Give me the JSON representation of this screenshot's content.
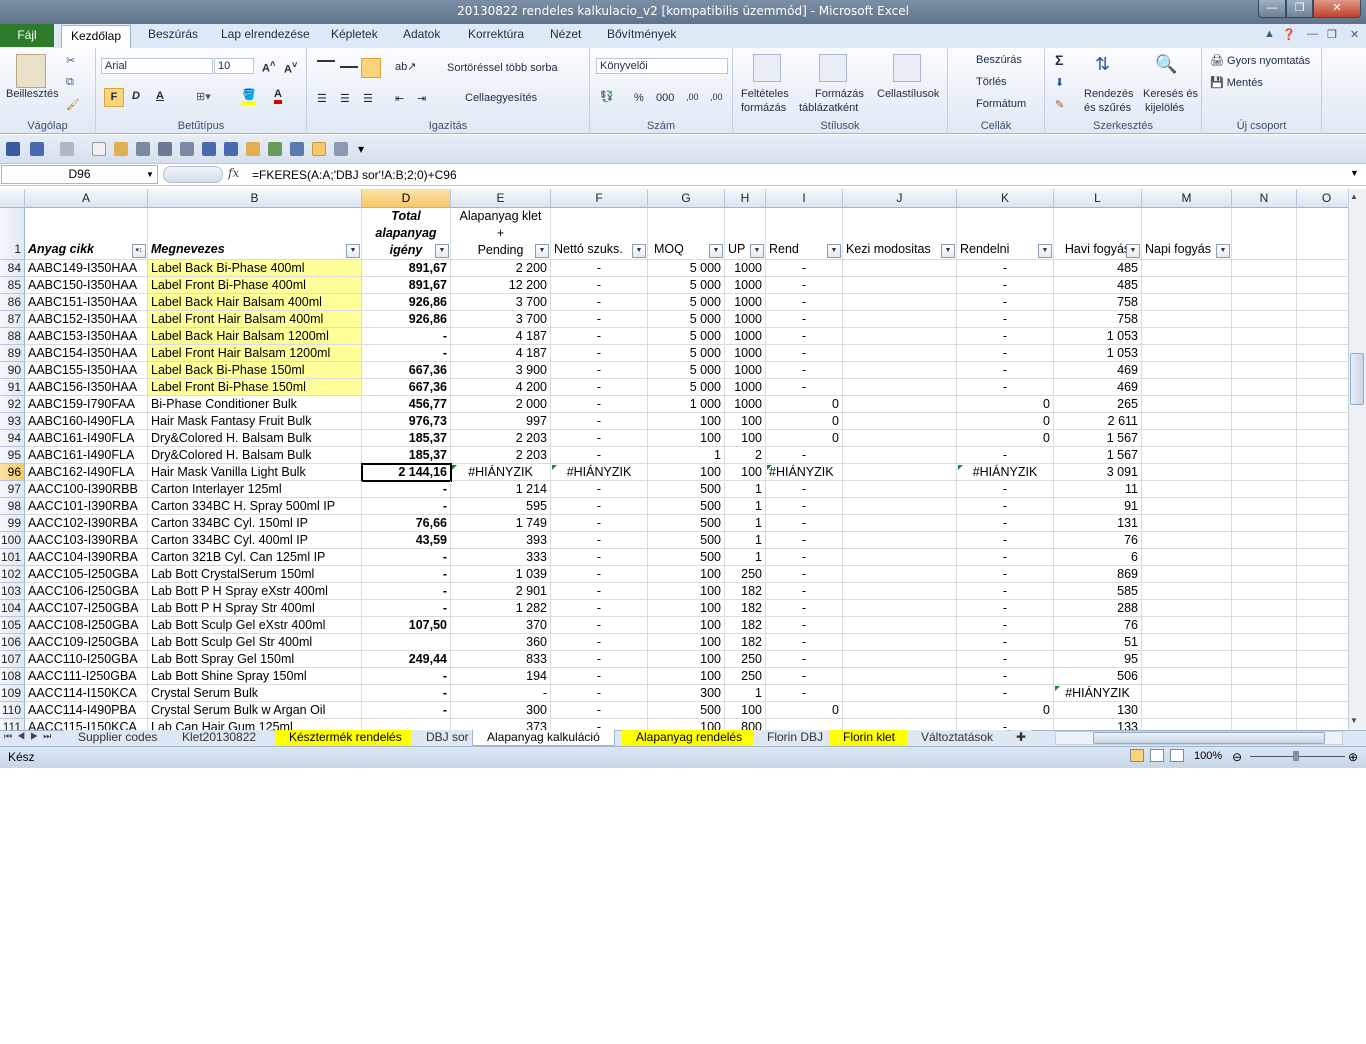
{
  "window": {
    "title": "20130822 rendeles kalkulacio_v2  [kompatibilis üzemmód]  -  Microsoft Excel"
  },
  "ribbon_tabs": [
    "Fájl",
    "Kezdőlap",
    "Beszúrás",
    "Lap elrendezése",
    "Képletek",
    "Adatok",
    "Korrektúra",
    "Nézet",
    "Bővítmények"
  ],
  "clipboard": {
    "paste": "Beillesztés",
    "group": "Vágólap"
  },
  "font": {
    "name": "Arial",
    "size": "10",
    "bold": "F",
    "italic": "D",
    "underline": "A",
    "group": "Betűtípus"
  },
  "alignment": {
    "wrap": "Sortöréssel több sorba",
    "merge": "Cellaegyesítés",
    "group": "Igazítás"
  },
  "number": {
    "format": "Könyvelői",
    "percent": "%",
    "thousands": "000",
    "inc": ",00",
    "dec": ",00",
    "group": "Szám"
  },
  "styles": {
    "cond_1": "Feltételes",
    "cond_2": "formázás",
    "table_1": "Formázás",
    "table_2": "táblázatként",
    "cellstyles": "Cellastílusok",
    "group": "Stílusok"
  },
  "cells": {
    "insert": "Beszúrás",
    "delete": "Törlés",
    "format": "Formátum",
    "group": "Cellák"
  },
  "editing": {
    "sum": "Σ",
    "sort_1": "Rendezés",
    "sort_2": "és szűrés",
    "find_1": "Keresés és",
    "find_2": "kijelölés",
    "group": "Szerkesztés"
  },
  "newgroup": {
    "quickprint": "Gyors nyomtatás",
    "save": "Mentés",
    "group": "Új csoport"
  },
  "formula_bar": {
    "namebox": "D96",
    "fx": "fx",
    "formula": "=FKERES(A:A;'DBJ sor'!A:B;2;0)+C96"
  },
  "columns": [
    "A",
    "B",
    "D",
    "E",
    "F",
    "G",
    "H",
    "I",
    "J",
    "K",
    "L",
    "M",
    "N",
    "O"
  ],
  "header_row": {
    "num": "1",
    "a": "Anyag cikk",
    "b": "Megnevezes",
    "d1": "Total",
    "d2": "alapanyag",
    "d3": "igény",
    "e1": "Alapanyag klet",
    "e2": "+",
    "e3": "Pending",
    "f": "Nettó szuks.",
    "g": "MOQ",
    "h": "UP",
    "i": "Rend",
    "j": "Kezi modositas",
    "k": "Rendelni",
    "l": "Havi fogyás",
    "m": "Napi fogyás"
  },
  "rows": [
    {
      "n": "84",
      "a": "AABC149-I350HAA",
      "b": "Label Back Bi-Phase 400ml",
      "d": "891,67",
      "e": "2 200",
      "f": "-",
      "g": "5 000",
      "h": "1000",
      "i": "-",
      "k": "-",
      "l": "485",
      "y": true
    },
    {
      "n": "85",
      "a": "AABC150-I350HAA",
      "b": "Label Front Bi-Phase 400ml",
      "d": "891,67",
      "e": "12 200",
      "f": "-",
      "g": "5 000",
      "h": "1000",
      "i": "-",
      "k": "-",
      "l": "485",
      "y": true
    },
    {
      "n": "86",
      "a": "AABC151-I350HAA",
      "b": "Label Back Hair Balsam 400ml",
      "d": "926,86",
      "e": "3 700",
      "f": "-",
      "g": "5 000",
      "h": "1000",
      "i": "-",
      "k": "-",
      "l": "758",
      "y": true
    },
    {
      "n": "87",
      "a": "AABC152-I350HAA",
      "b": "Label Front Hair Balsam 400ml",
      "d": "926,86",
      "e": "3 700",
      "f": "-",
      "g": "5 000",
      "h": "1000",
      "i": "-",
      "k": "-",
      "l": "758",
      "y": true
    },
    {
      "n": "88",
      "a": "AABC153-I350HAA",
      "b": "Label Back Hair Balsam 1200ml",
      "d": "-",
      "e": "4 187",
      "f": "-",
      "g": "5 000",
      "h": "1000",
      "i": "-",
      "k": "-",
      "l": "1 053",
      "y": true
    },
    {
      "n": "89",
      "a": "AABC154-I350HAA",
      "b": "Label Front Hair Balsam 1200ml",
      "d": "-",
      "e": "4 187",
      "f": "-",
      "g": "5 000",
      "h": "1000",
      "i": "-",
      "k": "-",
      "l": "1 053",
      "y": true
    },
    {
      "n": "90",
      "a": "AABC155-I350HAA",
      "b": "Label Back Bi-Phase 150ml",
      "d": "667,36",
      "e": "3 900",
      "f": "-",
      "g": "5 000",
      "h": "1000",
      "i": "-",
      "k": "-",
      "l": "469",
      "y": true
    },
    {
      "n": "91",
      "a": "AABC156-I350HAA",
      "b": "Label Front Bi-Phase 150ml",
      "d": "667,36",
      "e": "4 200",
      "f": "-",
      "g": "5 000",
      "h": "1000",
      "i": "-",
      "k": "-",
      "l": "469",
      "y": true
    },
    {
      "n": "92",
      "a": "AABC159-I790FAA",
      "b": "Bi-Phase Conditioner Bulk",
      "d": "456,77",
      "e": "2 000",
      "f": "-",
      "g": "1 000",
      "h": "1000",
      "i": "0",
      "k": "0",
      "l": "265"
    },
    {
      "n": "93",
      "a": "AABC160-I490FLA",
      "b": "Hair Mask Fantasy Fruit Bulk",
      "d": "976,73",
      "e": "997",
      "f": "-",
      "g": "100",
      "h": "100",
      "i": "0",
      "k": "0",
      "l": "2 611"
    },
    {
      "n": "94",
      "a": "AABC161-I490FLA",
      "b": "Dry&Colored H. Balsam Bulk",
      "d": "185,37",
      "e": "2 203",
      "f": "-",
      "g": "100",
      "h": "100",
      "i": "0",
      "k": "0",
      "l": "1 567"
    },
    {
      "n": "95",
      "a": "AABC161-I490FLA",
      "b": "Dry&Colored H. Balsam Bulk",
      "d": "185,37",
      "e": "2 203",
      "f": "-",
      "g": "1",
      "h": "2",
      "i": "-",
      "k": "-",
      "l": "1 567"
    },
    {
      "n": "96",
      "a": "AABC162-I490FLA",
      "b": "Hair Mask Vanilla Light Bulk",
      "d": "2 144,16",
      "e": "#HIÁNYZIK",
      "f": "#HIÁNYZIK",
      "g": "100",
      "h": "100",
      "i": "#HIÁNYZIK",
      "k": "#HIÁNYZIK",
      "l": "3 091",
      "sel": true
    },
    {
      "n": "97",
      "a": "AACC100-I390RBB",
      "b": "Carton Interlayer 125ml",
      "d": "-",
      "e": "1 214",
      "f": "-",
      "g": "500",
      "h": "1",
      "i": "-",
      "k": "-",
      "l": "11"
    },
    {
      "n": "98",
      "a": "AACC101-I390RBA",
      "b": "Carton 334BC H. Spray 500ml IP",
      "d": "-",
      "e": "595",
      "f": "-",
      "g": "500",
      "h": "1",
      "i": "-",
      "k": "-",
      "l": "91"
    },
    {
      "n": "99",
      "a": "AACC102-I390RBA",
      "b": "Carton 334BC Cyl. 150ml IP",
      "d": "76,66",
      "e": "1 749",
      "f": "-",
      "g": "500",
      "h": "1",
      "i": "-",
      "k": "-",
      "l": "131"
    },
    {
      "n": "100",
      "a": "AACC103-I390RBA",
      "b": "Carton 334BC Cyl. 400ml IP",
      "d": "43,59",
      "e": "393",
      "f": "-",
      "g": "500",
      "h": "1",
      "i": "-",
      "k": "-",
      "l": "76"
    },
    {
      "n": "101",
      "a": "AACC104-I390RBA",
      "b": "Carton 321B Cyl. Can 125ml IP",
      "d": "-",
      "e": "333",
      "f": "-",
      "g": "500",
      "h": "1",
      "i": "-",
      "k": "-",
      "l": "6"
    },
    {
      "n": "102",
      "a": "AACC105-I250GBA",
      "b": "Lab Bott CrystalSerum 150ml",
      "d": "-",
      "e": "1 039",
      "f": "-",
      "g": "100",
      "h": "250",
      "i": "-",
      "k": "-",
      "l": "869"
    },
    {
      "n": "103",
      "a": "AACC106-I250GBA",
      "b": "Lab Bott P H Spray eXstr 400ml",
      "d": "-",
      "e": "2 901",
      "f": "-",
      "g": "100",
      "h": "182",
      "i": "-",
      "k": "-",
      "l": "585"
    },
    {
      "n": "104",
      "a": "AACC107-I250GBA",
      "b": "Lab Bott P H Spray Str 400ml",
      "d": "-",
      "e": "1 282",
      "f": "-",
      "g": "100",
      "h": "182",
      "i": "-",
      "k": "-",
      "l": "288"
    },
    {
      "n": "105",
      "a": "AACC108-I250GBA",
      "b": "Lab Bott Sculp Gel eXstr 400ml",
      "d": "107,50",
      "e": "370",
      "f": "-",
      "g": "100",
      "h": "182",
      "i": "-",
      "k": "-",
      "l": "76"
    },
    {
      "n": "106",
      "a": "AACC109-I250GBA",
      "b": "Lab Bott Sculp Gel Str 400ml",
      "d": "",
      "e": "360",
      "f": "-",
      "g": "100",
      "h": "182",
      "i": "-",
      "k": "-",
      "l": "51"
    },
    {
      "n": "107",
      "a": "AACC110-I250GBA",
      "b": "Lab Bott Spray Gel 150ml",
      "d": "249,44",
      "e": "833",
      "f": "-",
      "g": "100",
      "h": "250",
      "i": "-",
      "k": "-",
      "l": "95"
    },
    {
      "n": "108",
      "a": "AACC111-I250GBA",
      "b": "Lab Bott Shine Spray 150ml",
      "d": "-",
      "e": "194",
      "f": "-",
      "g": "100",
      "h": "250",
      "i": "-",
      "k": "-",
      "l": "506"
    },
    {
      "n": "109",
      "a": "AACC114-I150KCA",
      "b": "Crystal Serum Bulk",
      "d": "-",
      "e": "-",
      "f": "-",
      "g": "300",
      "h": "1",
      "i": "-",
      "k": "-",
      "l": "#HIÁNYZIK"
    },
    {
      "n": "110",
      "a": "AACC114-I490PBA",
      "b": "Crystal Serum Bulk w Argan Oil",
      "d": "-",
      "e": "300",
      "f": "-",
      "g": "500",
      "h": "100",
      "i": "0",
      "k": "0",
      "l": "130"
    },
    {
      "n": "111",
      "a": "AACC115-I150KCA",
      "b": "Lab Can Hair Gum 125ml",
      "d": "",
      "e": "373",
      "f": "-",
      "g": "100",
      "h": "800",
      "i": "",
      "k": "-",
      "l": "133"
    }
  ],
  "sheets": [
    "Supplier codes",
    "Klet20130822",
    "Késztermék rendelés",
    "DBJ sor",
    "Alapanyag kalkuláció",
    "Alapanyag rendelés",
    "Florin DBJ",
    "Florin klet",
    "Változtatások"
  ],
  "status": {
    "text": "Kész",
    "zoom": "100%"
  }
}
